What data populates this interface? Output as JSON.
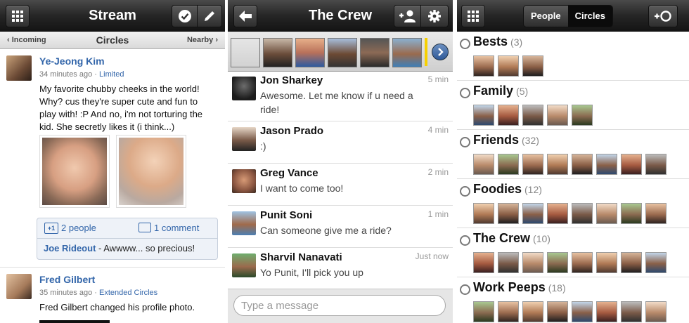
{
  "stream": {
    "title": "Stream",
    "subnav": {
      "left": "‹ Incoming",
      "center": "Circles",
      "right": "Nearby ›"
    },
    "posts": [
      {
        "author": "Ye-Jeong Kim",
        "time": "34 minutes ago",
        "visibility": "Limited",
        "text": "My favorite chubby cheeks in the world! Why? cus they're super cute and fun to play with! :P And no, i'm not torturing the kid. She secretly likes it (i think...)",
        "plus_one": "2 people",
        "comments": "1 comment",
        "comment_author": "Joe Rideout",
        "comment_text": " - Awwww... so precious!"
      },
      {
        "author": "Fred Gilbert",
        "time": "35 minutes ago",
        "visibility": "Extended Circles",
        "text": "Fred Gilbert changed his profile photo."
      }
    ]
  },
  "crew": {
    "title": "The Crew",
    "messages": [
      {
        "name": "Jon Sharkey",
        "time": "5 min",
        "text": "Awesome. Let me know if u need a ride!"
      },
      {
        "name": "Jason Prado",
        "time": "4 min",
        "text": ":)"
      },
      {
        "name": "Greg Vance",
        "time": "2 min",
        "text": "I want to come too!"
      },
      {
        "name": "Punit Soni",
        "time": "1 min",
        "text": "Can someone give me a ride?"
      },
      {
        "name": "Sharvil Nanavati",
        "time": "Just now",
        "text": "Yo Punit, I'll pick you up"
      }
    ],
    "composer_placeholder": "Type a message"
  },
  "circles": {
    "tabs": [
      "People",
      "Circles"
    ],
    "active_tab": "Circles",
    "list": [
      {
        "name": "Bests",
        "count": "(3)",
        "faces": 3
      },
      {
        "name": "Family",
        "count": "(5)",
        "faces": 5
      },
      {
        "name": "Friends",
        "count": "(32)",
        "faces": 8
      },
      {
        "name": "Foodies",
        "count": "(12)",
        "faces": 8
      },
      {
        "name": "The Crew",
        "count": "(10)",
        "faces": 8
      },
      {
        "name": "Work Peeps",
        "count": "(18)",
        "faces": 8
      }
    ]
  },
  "icons": {
    "stream_left": "grid-icon",
    "stream_right": [
      "checkin-icon",
      "compose-icon"
    ],
    "crew_left": "back-arrow-icon",
    "crew_right": [
      "add-person-icon",
      "gear-icon"
    ],
    "circles_left": "grid-icon",
    "circles_right": "add-circle-icon",
    "strip_next": "chevron-right-icon",
    "radio": "radio-icon"
  },
  "colors": {
    "link": "#3366aa",
    "topbar": "#1e1e1e",
    "accent": "#3366aa"
  }
}
